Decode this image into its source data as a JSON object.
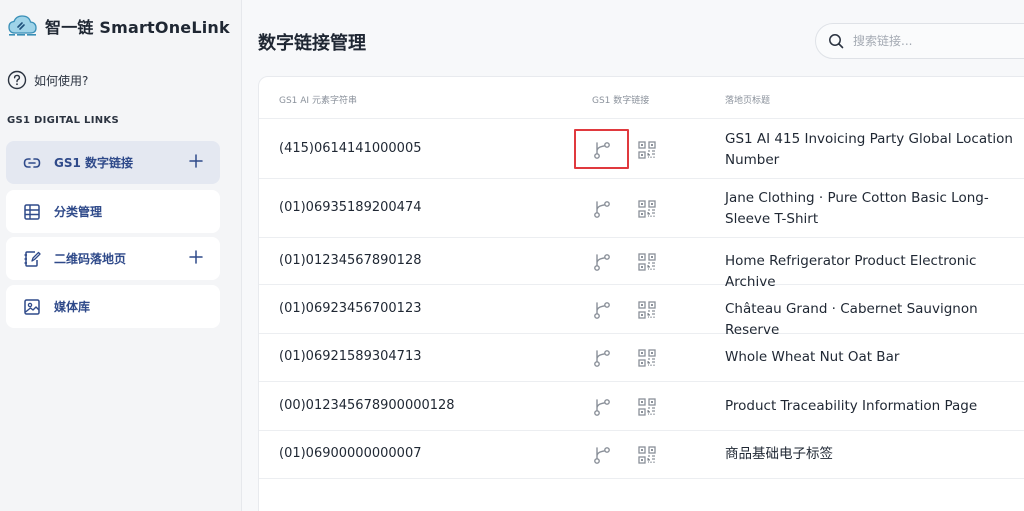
{
  "brand": {
    "name": "智一链 SmartOneLink"
  },
  "help": {
    "label": "如何使用?"
  },
  "sidebar": {
    "section_label": "GS1 DIGITAL LINKS",
    "items": [
      {
        "label": "GS1 数字链接",
        "icon": "link-icon",
        "active": true,
        "has_plus": true
      },
      {
        "label": "分类管理",
        "icon": "table-icon",
        "active": false,
        "has_plus": false
      },
      {
        "label": "二维码落地页",
        "icon": "edit-page-icon",
        "active": false,
        "has_plus": true
      },
      {
        "label": "媒体库",
        "icon": "image-icon",
        "active": false,
        "has_plus": false
      }
    ]
  },
  "main": {
    "title": "数字链接管理",
    "search": {
      "placeholder": "搜索链接..."
    }
  },
  "table": {
    "headers": {
      "code": "GS1 AI 元素字符串",
      "link": "GS1 数字链接",
      "title": "落地页标题"
    },
    "rows": [
      {
        "code": "(415)0614141000005",
        "title": "GS1 AI 415 Invoicing Party Global Location Number"
      },
      {
        "code": "(01)06935189200474",
        "title": "Jane Clothing · Pure Cotton Basic Long-Sleeve T-Shirt"
      },
      {
        "code": "(01)01234567890128",
        "title": "Home Refrigerator Product Electronic Archive"
      },
      {
        "code": "(01)06923456700123",
        "title": "Château Grand · Cabernet Sauvignon Reserve"
      },
      {
        "code": "(01)06921589304713",
        "title": "Whole Wheat Nut Oat Bar"
      },
      {
        "code": "(00)012345678900000128",
        "title": "Product Traceability Information Page"
      },
      {
        "code": "(01)06900000000007",
        "title": "商品基础电子标签"
      }
    ]
  },
  "colors": {
    "accent": "#2f4a8a",
    "active_bg": "#e4e8f1",
    "highlight": "#e0393e",
    "icon": "#8a9099"
  }
}
